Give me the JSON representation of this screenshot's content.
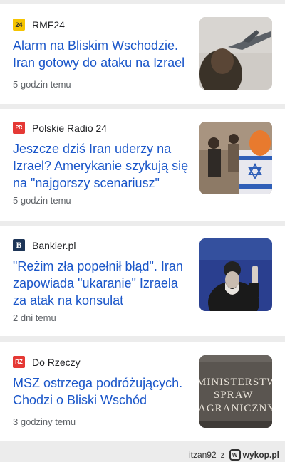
{
  "articles": [
    {
      "source": "RMF24",
      "logo_text": "24",
      "headline": "Alarm na Bliskim Wschodzie. Iran gotowy do ataku na Izrael",
      "time": "5 godzin temu"
    },
    {
      "source": "Polskie Radio 24",
      "logo_text": "PR",
      "headline": "Jeszcze dziś Iran uderzy na Izrael? Amerykanie szykują się na \"najgorszy scenariusz\"",
      "time": "5 godzin temu"
    },
    {
      "source": "Bankier.pl",
      "logo_text": "B",
      "headline": "\"Reżim zła popełnił błąd\". Iran zapowiada \"ukaranie\" Izraela za atak na konsulat",
      "time": "2 dni temu"
    },
    {
      "source": "Do Rzeczy",
      "logo_text": "RZ",
      "headline": "MSZ ostrzega podróżujących. Chodzi o Bliski Wschód",
      "time": "3 godziny temu"
    }
  ],
  "thumb4_text": [
    "MINISTERSTW",
    "SPRAW",
    "AGRANICZNY"
  ],
  "footer": {
    "user": "itzan92",
    "z": "z",
    "brand": "wykop.pl"
  }
}
